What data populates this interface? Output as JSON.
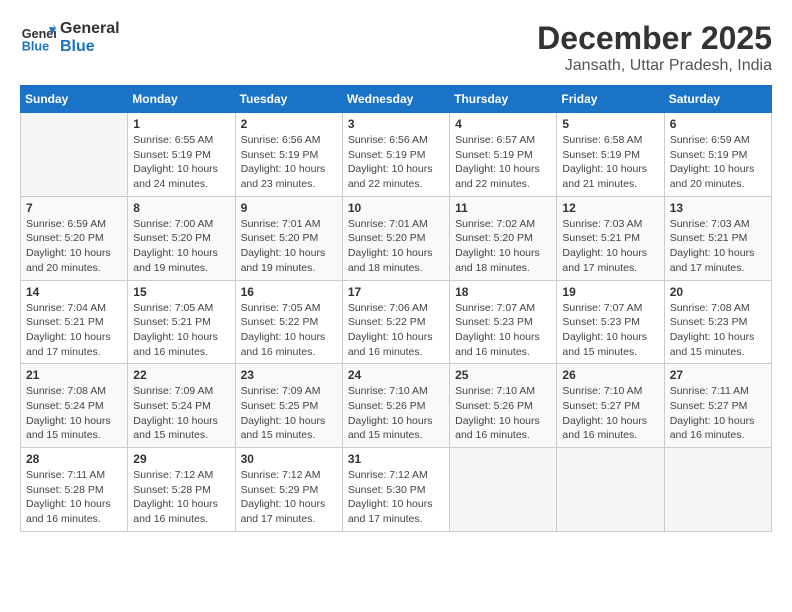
{
  "logo": {
    "text_general": "General",
    "text_blue": "Blue"
  },
  "header": {
    "month": "December 2025",
    "location": "Jansath, Uttar Pradesh, India"
  },
  "weekdays": [
    "Sunday",
    "Monday",
    "Tuesday",
    "Wednesday",
    "Thursday",
    "Friday",
    "Saturday"
  ],
  "weeks": [
    [
      {
        "day": "",
        "info": ""
      },
      {
        "day": "1",
        "info": "Sunrise: 6:55 AM\nSunset: 5:19 PM\nDaylight: 10 hours\nand 24 minutes."
      },
      {
        "day": "2",
        "info": "Sunrise: 6:56 AM\nSunset: 5:19 PM\nDaylight: 10 hours\nand 23 minutes."
      },
      {
        "day": "3",
        "info": "Sunrise: 6:56 AM\nSunset: 5:19 PM\nDaylight: 10 hours\nand 22 minutes."
      },
      {
        "day": "4",
        "info": "Sunrise: 6:57 AM\nSunset: 5:19 PM\nDaylight: 10 hours\nand 22 minutes."
      },
      {
        "day": "5",
        "info": "Sunrise: 6:58 AM\nSunset: 5:19 PM\nDaylight: 10 hours\nand 21 minutes."
      },
      {
        "day": "6",
        "info": "Sunrise: 6:59 AM\nSunset: 5:19 PM\nDaylight: 10 hours\nand 20 minutes."
      }
    ],
    [
      {
        "day": "7",
        "info": "Sunrise: 6:59 AM\nSunset: 5:20 PM\nDaylight: 10 hours\nand 20 minutes."
      },
      {
        "day": "8",
        "info": "Sunrise: 7:00 AM\nSunset: 5:20 PM\nDaylight: 10 hours\nand 19 minutes."
      },
      {
        "day": "9",
        "info": "Sunrise: 7:01 AM\nSunset: 5:20 PM\nDaylight: 10 hours\nand 19 minutes."
      },
      {
        "day": "10",
        "info": "Sunrise: 7:01 AM\nSunset: 5:20 PM\nDaylight: 10 hours\nand 18 minutes."
      },
      {
        "day": "11",
        "info": "Sunrise: 7:02 AM\nSunset: 5:20 PM\nDaylight: 10 hours\nand 18 minutes."
      },
      {
        "day": "12",
        "info": "Sunrise: 7:03 AM\nSunset: 5:21 PM\nDaylight: 10 hours\nand 17 minutes."
      },
      {
        "day": "13",
        "info": "Sunrise: 7:03 AM\nSunset: 5:21 PM\nDaylight: 10 hours\nand 17 minutes."
      }
    ],
    [
      {
        "day": "14",
        "info": "Sunrise: 7:04 AM\nSunset: 5:21 PM\nDaylight: 10 hours\nand 17 minutes."
      },
      {
        "day": "15",
        "info": "Sunrise: 7:05 AM\nSunset: 5:21 PM\nDaylight: 10 hours\nand 16 minutes."
      },
      {
        "day": "16",
        "info": "Sunrise: 7:05 AM\nSunset: 5:22 PM\nDaylight: 10 hours\nand 16 minutes."
      },
      {
        "day": "17",
        "info": "Sunrise: 7:06 AM\nSunset: 5:22 PM\nDaylight: 10 hours\nand 16 minutes."
      },
      {
        "day": "18",
        "info": "Sunrise: 7:07 AM\nSunset: 5:23 PM\nDaylight: 10 hours\nand 16 minutes."
      },
      {
        "day": "19",
        "info": "Sunrise: 7:07 AM\nSunset: 5:23 PM\nDaylight: 10 hours\nand 15 minutes."
      },
      {
        "day": "20",
        "info": "Sunrise: 7:08 AM\nSunset: 5:23 PM\nDaylight: 10 hours\nand 15 minutes."
      }
    ],
    [
      {
        "day": "21",
        "info": "Sunrise: 7:08 AM\nSunset: 5:24 PM\nDaylight: 10 hours\nand 15 minutes."
      },
      {
        "day": "22",
        "info": "Sunrise: 7:09 AM\nSunset: 5:24 PM\nDaylight: 10 hours\nand 15 minutes."
      },
      {
        "day": "23",
        "info": "Sunrise: 7:09 AM\nSunset: 5:25 PM\nDaylight: 10 hours\nand 15 minutes."
      },
      {
        "day": "24",
        "info": "Sunrise: 7:10 AM\nSunset: 5:26 PM\nDaylight: 10 hours\nand 15 minutes."
      },
      {
        "day": "25",
        "info": "Sunrise: 7:10 AM\nSunset: 5:26 PM\nDaylight: 10 hours\nand 16 minutes."
      },
      {
        "day": "26",
        "info": "Sunrise: 7:10 AM\nSunset: 5:27 PM\nDaylight: 10 hours\nand 16 minutes."
      },
      {
        "day": "27",
        "info": "Sunrise: 7:11 AM\nSunset: 5:27 PM\nDaylight: 10 hours\nand 16 minutes."
      }
    ],
    [
      {
        "day": "28",
        "info": "Sunrise: 7:11 AM\nSunset: 5:28 PM\nDaylight: 10 hours\nand 16 minutes."
      },
      {
        "day": "29",
        "info": "Sunrise: 7:12 AM\nSunset: 5:28 PM\nDaylight: 10 hours\nand 16 minutes."
      },
      {
        "day": "30",
        "info": "Sunrise: 7:12 AM\nSunset: 5:29 PM\nDaylight: 10 hours\nand 17 minutes."
      },
      {
        "day": "31",
        "info": "Sunrise: 7:12 AM\nSunset: 5:30 PM\nDaylight: 10 hours\nand 17 minutes."
      },
      {
        "day": "",
        "info": ""
      },
      {
        "day": "",
        "info": ""
      },
      {
        "day": "",
        "info": ""
      }
    ]
  ]
}
